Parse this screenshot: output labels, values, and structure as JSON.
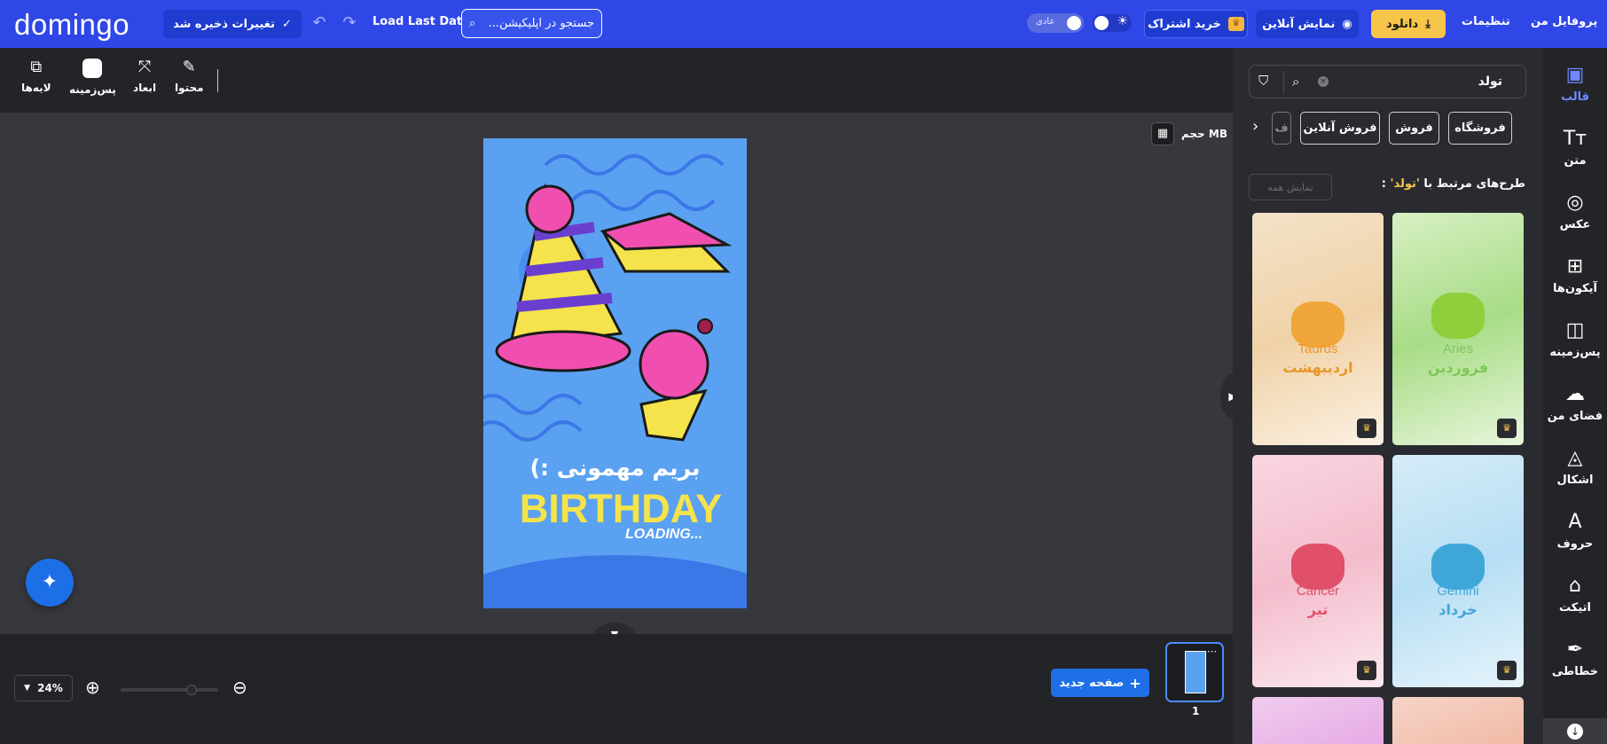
{
  "app": {
    "logo": "domingo",
    "save_label": "تغییرات ذخیره شد",
    "load_last_label": "Load Last Data",
    "search_text": "جستجو در اپلیکیشن...",
    "mode_label": "عادی",
    "subscribe_label": "خرید اشتراک",
    "online_label": "نمایش آنلاین",
    "download_label": "دانلود",
    "settings_label": "تنظیمات",
    "profile_label": "پروفایل من"
  },
  "rail": {
    "items": [
      {
        "label": "قالب",
        "icon": "template-icon"
      },
      {
        "label": "متن",
        "icon": "text-icon"
      },
      {
        "label": "عکس",
        "icon": "image-icon"
      },
      {
        "label": "آیکون‌ها",
        "icon": "grid-icon"
      },
      {
        "label": "پس‌زمینه",
        "icon": "background-icon"
      },
      {
        "label": "فضای من",
        "icon": "cloud-upload-icon"
      },
      {
        "label": "اشکال",
        "icon": "shapes-icon"
      },
      {
        "label": "حروف",
        "icon": "letters-icon"
      },
      {
        "label": "اتیکت",
        "icon": "tag-icon"
      },
      {
        "label": "خطاطی",
        "icon": "feather-icon"
      }
    ]
  },
  "panel": {
    "search_value": "تولد",
    "chips": [
      "فروشگاه",
      "فروش",
      "فروش آنلاین",
      "ف"
    ],
    "related_prefix": "طرح‌های مرتبط با",
    "related_term": "'تولد'",
    "related_suffix": ":",
    "show_all_label": "نمایش همه",
    "templates": [
      {
        "en": "Aries",
        "fa": "فروردین",
        "color": "#7cc85a"
      },
      {
        "en": "Taurus",
        "fa": "اردیبهشت",
        "color": "#e8962a"
      },
      {
        "en": "Gemini",
        "fa": "خرداد",
        "color": "#3fa7d8"
      },
      {
        "en": "Cancer",
        "fa": "تیر",
        "color": "#e0506a"
      }
    ]
  },
  "tools": {
    "content_label": "محتوا",
    "dimensions_label": "ابعاد",
    "background_label": "پس‌زمینه",
    "layers_label": "لایه‌ها"
  },
  "canvas": {
    "size_label": "حجم MB",
    "design_text_fa": "بریم مهمونی :)",
    "design_text_en": "BIRTHDAY",
    "design_text_loading": "LOADING...",
    "design_bg": "#5ba1f1"
  },
  "bottom": {
    "zoom_value": "24%",
    "zoom_fraction": 0.24,
    "new_page_label": "صفحه جدید",
    "page_number": "1"
  }
}
